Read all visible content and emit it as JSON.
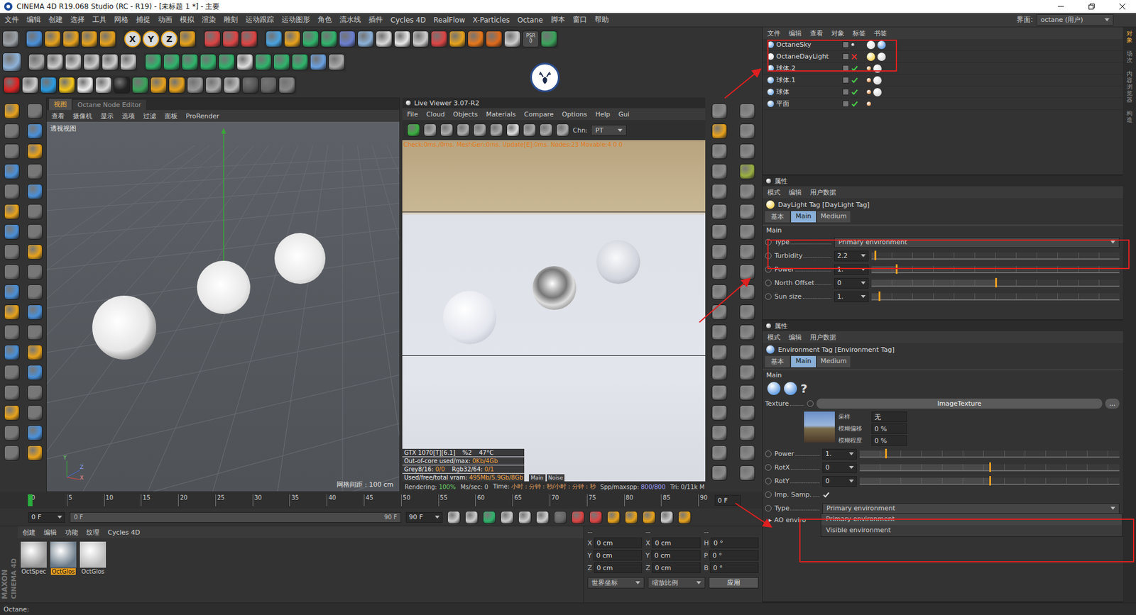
{
  "window": {
    "title": "CINEMA 4D R19.068 Studio (RC - R19) - [未标题 1 *] - 主要"
  },
  "menu": [
    "文件",
    "编辑",
    "创建",
    "选择",
    "工具",
    "网格",
    "捕捉",
    "动画",
    "模拟",
    "渲染",
    "雕刻",
    "运动跟踪",
    "运动图形",
    "角色",
    "流水线",
    "插件",
    "Cycles 4D",
    "RealFlow",
    "X-Particles",
    "Octane",
    "脚本",
    "窗口",
    "帮助"
  ],
  "layout": {
    "label": "界面:",
    "value": "octane (用户)"
  },
  "toolbar": {
    "axes": [
      "X",
      "Y",
      "Z"
    ],
    "psr": {
      "label": "PSR",
      "value": "0"
    }
  },
  "viewport": {
    "tabs": [
      {
        "label": "视图",
        "selected": true
      },
      {
        "label": "Octane Node Editor",
        "selected": false
      }
    ],
    "menu": [
      "查看",
      "摄像机",
      "显示",
      "选项",
      "过滤",
      "面板",
      "ProRender"
    ],
    "title": "透视视图",
    "grid": "网格间距 : 100 cm",
    "gizmo": [
      "Y",
      "Z",
      "X"
    ]
  },
  "live_viewer": {
    "title": "Live Viewer 3.07-R2",
    "menu": [
      "File",
      "Cloud",
      "Objects",
      "Materials",
      "Compare",
      "Options",
      "Help",
      "Gui"
    ],
    "channel": {
      "label": "Chn:",
      "value": "PT"
    },
    "check": "Check:0ms./0ms. MeshGen:0ms. Update[E]:0ms. Nodes:23 Movable:4  0 0",
    "info": [
      [
        {
          "label": "GTX 1070[T][6.1]",
          "value": ""
        },
        {
          "label": "%2",
          "value": ""
        },
        {
          "label": "47°C",
          "value": ""
        }
      ],
      [
        {
          "label": "Out-of-core used/max:",
          "value": "0Kb/4Gb"
        }
      ],
      [
        {
          "label": "Grey8/16:",
          "value": "0/0"
        },
        {
          "label": "Rgb32/64:",
          "value": "0/1"
        }
      ],
      [
        {
          "label": "Used/free/total vram:",
          "value": "495Mb/5.9Gb/8Gb"
        }
      ]
    ],
    "modes": [
      "Main",
      "Noise"
    ],
    "status": [
      {
        "label": "Rendering:",
        "value": "100%"
      },
      {
        "label": "Ms/sec:",
        "value": "0"
      },
      {
        "label": "Time:",
        "value": "小时 : 分钟 : 秒/小时 : 分钟 : 秒"
      },
      {
        "label": "Spp/maxspp:",
        "value": "800/800"
      },
      {
        "label": "Tri:",
        "value": "0/11k M"
      }
    ]
  },
  "objects": {
    "menu": [
      "文件",
      "编辑",
      "查看",
      "对象",
      "标签",
      "书签"
    ],
    "items": [
      {
        "name": "OctaneSky",
        "kind": "sky",
        "checked": false,
        "crossed": false
      },
      {
        "name": "OctaneDayLight",
        "kind": "light",
        "checked": false,
        "crossed": true
      },
      {
        "name": "球体.2",
        "kind": "sphere",
        "checked": true,
        "crossed": false
      },
      {
        "name": "球体.1",
        "kind": "sphere",
        "checked": true,
        "crossed": false
      },
      {
        "name": "球体",
        "kind": "sphere",
        "checked": true,
        "crossed": false
      },
      {
        "name": "平面",
        "kind": "plane",
        "checked": true,
        "crossed": false
      }
    ]
  },
  "side_tabs": [
    {
      "label": "对象",
      "selected": true
    },
    {
      "label": "场次",
      "selected": false
    },
    {
      "label": "内容浏览器",
      "selected": false
    },
    {
      "label": "构造",
      "selected": false
    }
  ],
  "attr1": {
    "header": "属性",
    "menu": [
      "模式",
      "编辑",
      "用户数据"
    ],
    "title": "DayLight Tag [DayLight Tag]",
    "tabs": [
      {
        "label": "基本",
        "selected": false
      },
      {
        "label": "Main",
        "selected": true
      },
      {
        "label": "Medium",
        "selected": false
      }
    ],
    "section": "Main",
    "rows": [
      {
        "label": "Type",
        "kind": "dropdown",
        "value": "Primary environment"
      },
      {
        "label": "Turbidity",
        "kind": "slider",
        "value": "2.2",
        "level": 0.015
      },
      {
        "label": "Power",
        "kind": "slider",
        "value": "1.",
        "level": 0.1
      },
      {
        "label": "North Offset",
        "kind": "slider",
        "value": "0",
        "level": 0.5
      },
      {
        "label": "Sun size",
        "kind": "slider",
        "value": "1.",
        "level": 0.03
      }
    ]
  },
  "attr2": {
    "header": "属性",
    "menu": [
      "模式",
      "编辑",
      "用户数据"
    ],
    "title": "Environment Tag [Environment Tag]",
    "tabs": [
      {
        "label": "基本",
        "selected": false
      },
      {
        "label": "Main",
        "selected": true
      },
      {
        "label": "Medium",
        "selected": false
      }
    ],
    "section": "Main",
    "help": "?",
    "texture": {
      "label": "Texture",
      "value": "ImageTexture",
      "more": "...",
      "fields": [
        {
          "label": "采样",
          "value": "无"
        },
        {
          "label": "模糊偏移",
          "value": "0 %"
        },
        {
          "label": "模糊程度",
          "value": "0 %"
        }
      ]
    },
    "rows": [
      {
        "label": "Power",
        "kind": "slider",
        "value": "1.",
        "level": 0.1
      },
      {
        "label": "RotX",
        "kind": "slider",
        "value": "0",
        "level": 0.5
      },
      {
        "label": "RotY",
        "kind": "slider",
        "value": "0",
        "level": 0.5
      },
      {
        "label": "Imp. Samp.",
        "kind": "checkbox",
        "checked": true
      },
      {
        "label": "Type",
        "kind": "dropdown",
        "value": "Primary environment",
        "open": true
      }
    ],
    "dropdown": [
      {
        "label": "Primary environment",
        "selected": true
      },
      {
        "label": "Visible environment",
        "selected": false
      }
    ],
    "ao": {
      "arrow": "▸",
      "label": "AO enviro"
    }
  },
  "timeline": {
    "ticks": [
      "0",
      "5",
      "10",
      "15",
      "20",
      "25",
      "30",
      "35",
      "40",
      "45",
      "50",
      "55",
      "60",
      "65",
      "70",
      "75",
      "80",
      "85",
      "90"
    ],
    "frame": "0 F",
    "level": 0
  },
  "transport": {
    "start": "0 F",
    "range_start": "0 F",
    "range_end": "90 F",
    "end": "90 F"
  },
  "materials": {
    "menu": [
      "创建",
      "编辑",
      "功能",
      "纹理",
      "Cycles 4D"
    ],
    "items": [
      {
        "name": "OctSpec",
        "selected": false
      },
      {
        "name": "OctGlos",
        "selected": true
      },
      {
        "name": "OctGlos",
        "selected": false
      }
    ]
  },
  "coords": {
    "headers": [
      "--",
      "--",
      "--"
    ],
    "columns": [
      [
        {
          "axis": "X",
          "value": "0 cm"
        },
        {
          "axis": "Y",
          "value": "0 cm"
        },
        {
          "axis": "Z",
          "value": "0 cm"
        }
      ],
      [
        {
          "axis": "X",
          "value": "0 cm"
        },
        {
          "axis": "Y",
          "value": "0 cm"
        },
        {
          "axis": "Z",
          "value": "0 cm"
        }
      ],
      [
        {
          "axis": "H",
          "value": "0 °"
        },
        {
          "axis": "P",
          "value": "0 °"
        },
        {
          "axis": "B",
          "value": "0 °"
        }
      ]
    ],
    "modes": [
      "世界坐标",
      "缩放比例"
    ],
    "apply": "应用"
  },
  "brand": [
    "MAXON",
    "CINEMA 4D"
  ],
  "status_bar": "Octane:"
}
